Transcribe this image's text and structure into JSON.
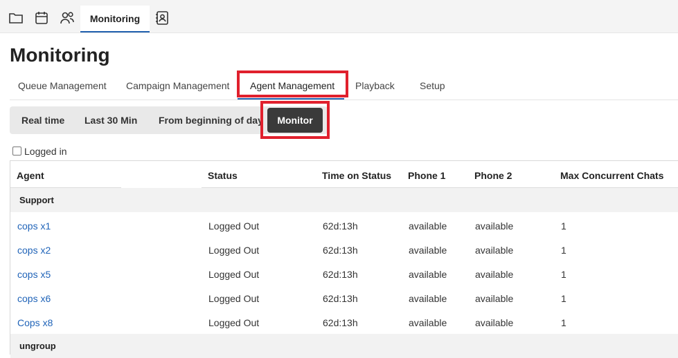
{
  "app_tab": {
    "label": "Monitoring"
  },
  "page_title": "Monitoring",
  "tabs": [
    {
      "label": "Queue Management"
    },
    {
      "label": "Campaign Management"
    },
    {
      "label": "Agent Management"
    },
    {
      "label": "Playback"
    },
    {
      "label": "Setup"
    }
  ],
  "filters": [
    {
      "label": "Real time"
    },
    {
      "label": "Last 30 Min"
    },
    {
      "label": "From beginning of day"
    },
    {
      "label": "Monitor"
    }
  ],
  "logged_in_label": "Logged in",
  "table": {
    "headers": [
      "Agent",
      "Status",
      "Time on Status",
      "Phone 1",
      "Phone 2",
      "Max Concurrent Chats"
    ],
    "groups": [
      {
        "name": "Support",
        "rows": [
          {
            "agent": "cops x1",
            "status": "Logged Out",
            "time": "62d:13h",
            "phone1": "available",
            "phone2": "available",
            "max": "1"
          },
          {
            "agent": "cops x2",
            "status": "Logged Out",
            "time": "62d:13h",
            "phone1": "available",
            "phone2": "available",
            "max": "1"
          },
          {
            "agent": "cops x5",
            "status": "Logged Out",
            "time": "62d:13h",
            "phone1": "available",
            "phone2": "available",
            "max": "1"
          },
          {
            "agent": "cops x6",
            "status": "Logged Out",
            "time": "62d:13h",
            "phone1": "available",
            "phone2": "available",
            "max": "1"
          },
          {
            "agent": "Cops x8",
            "status": "Logged Out",
            "time": "62d:13h",
            "phone1": "available",
            "phone2": "available",
            "max": "1"
          }
        ]
      },
      {
        "name": "ungroup",
        "rows": []
      }
    ]
  },
  "colors": {
    "accent": "#1f5fae",
    "highlight": "#e0202d",
    "link": "#1f63b8",
    "active_button": "#3a3a3a"
  },
  "icons": [
    "folder-icon",
    "calendar-icon",
    "users-icon",
    "contacts-icon"
  ]
}
